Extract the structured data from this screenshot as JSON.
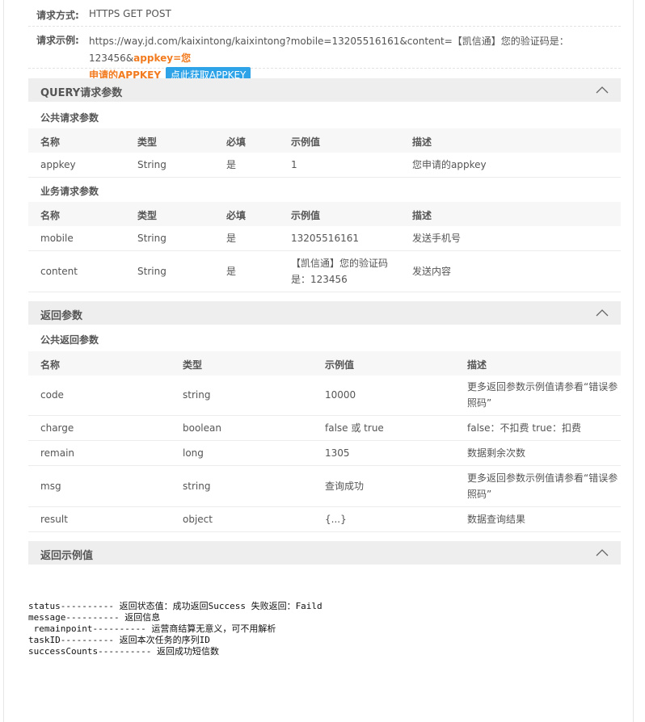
{
  "request": {
    "method_label": "请求方式:",
    "method_value": "HTTPS GET POST",
    "example_label": "请求示例:",
    "example_url": "https://way.jd.com/kaixintong/kaixintong?mobile=13205516161&content=【凯信通】您的验证码是：123456&",
    "example_key_part1": "appkey=您",
    "example_key_part2": "申请的APPKEY",
    "apply_button": "点此获取APPKEY"
  },
  "query_section": {
    "title": "QUERY请求参数",
    "public_title": "公共请求参数",
    "biz_title": "业务请求参数",
    "headers": [
      "名称",
      "类型",
      "必填",
      "示例值",
      "描述"
    ],
    "public_rows": [
      [
        "appkey",
        "String",
        "是",
        "1",
        "您申请的appkey"
      ]
    ],
    "biz_rows": [
      [
        "mobile",
        "String",
        "是",
        "13205516161",
        "发送手机号"
      ],
      [
        "content",
        "String",
        "是",
        "【凯信通】您的验证码",
        "是：123456",
        "发送内容"
      ]
    ]
  },
  "return_section": {
    "title": "返回参数",
    "public_title": "公共返回参数",
    "headers": [
      "名称",
      "类型",
      "示例值",
      "描述"
    ],
    "rows": [
      {
        "name": "code",
        "type": "string",
        "example": "10000",
        "desc1": "更多返回参数示例值请参看“错误参",
        "desc2": "照码”"
      },
      {
        "name": "charge",
        "type": "boolean",
        "example": "false 或 true",
        "desc1": "false：不扣费 true：扣费",
        "desc2": ""
      },
      {
        "name": "remain",
        "type": "long",
        "example": "1305",
        "desc1": "数据剩余次数",
        "desc2": ""
      },
      {
        "name": "msg",
        "type": "string",
        "example": "查询成功",
        "desc1": "更多返回参数示例值请参看“错误参",
        "desc2": "照码”"
      },
      {
        "name": "result",
        "type": "object",
        "example": "{...}",
        "desc1": "数据查询结果",
        "desc2": ""
      }
    ]
  },
  "example_section": {
    "title": "返回示例值",
    "lines": [
      "status---------- 返回状态值：成功返回Success 失败返回：Faild",
      "message---------- 返回信息",
      " remainpoint---------- 运营商结算无意义，可不用解析",
      "taskID---------- 返回本次任务的序列ID",
      "successCounts---------- 返回成功短信数"
    ]
  },
  "icons": {
    "collapse": "chevron-up-icon"
  }
}
